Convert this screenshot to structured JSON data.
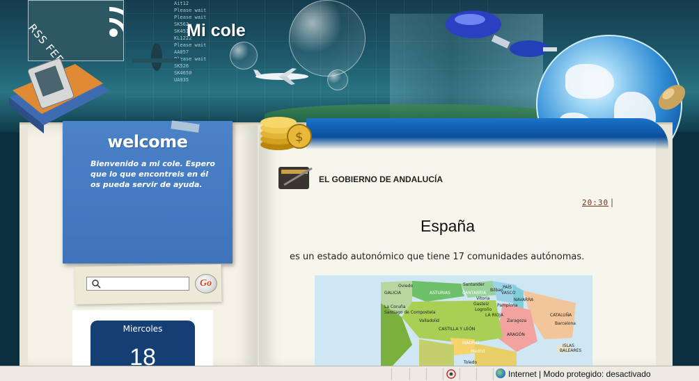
{
  "header": {
    "site_title": "Mi cole",
    "rss_label": "RSS FEED"
  },
  "flight_board": [
    "Ait12",
    "Please wait",
    "Please wait",
    "SK562",
    "SK451",
    "KL1222",
    "Please wait",
    "AA057",
    "Please wait",
    "SK526",
    "SK4650",
    "UA935"
  ],
  "sidebar": {
    "welcome_title": "welcome",
    "welcome_text": "Bienvenido a mi cole. Espero que lo que encontreis en él os pueda servir de ayuda.",
    "search_placeholder": "",
    "search_button_label": "Go",
    "calendar": {
      "day_name": "Miercoles",
      "day_number": "18"
    }
  },
  "post": {
    "title": "EL GOBIERNO DE ANDALUCÍA",
    "time": "20:30",
    "separator": "|",
    "heading": "España",
    "body": "es un estado autonómico que tiene 17 comunidades autónomas.",
    "map_labels": {
      "galicia": "GALICIA",
      "asturias": "ASTURIAS",
      "oviedo": "Oviedo",
      "santander": "Santander",
      "bilbao": "Bilbao",
      "pais": "PAÍS",
      "vasco": "VASCO",
      "cantabria": "CANTABRIA",
      "coruna": "La Coruña",
      "santiago": "Santiago de Compostela",
      "vitoria": "Vitoria",
      "navarra": "NAVARRA",
      "pamplona": "Pamplona",
      "logrono": "Logroño",
      "rioja": "LA RIOJA",
      "gasteiz": "Gasteiz",
      "cataluna": "CATALUÑA",
      "valladolid": "Valladolid",
      "zaragoza": "Zaragoza",
      "barcelona": "Barcelona",
      "castilla_leon": "CASTILLA Y LEÓN",
      "aragon": "ARAGÓN",
      "madrid_c": "MADRID",
      "madrid": "Madrid",
      "toledo": "Toledo",
      "islas": "ISLAS",
      "baleares": "BALEARES"
    }
  },
  "statusbar": {
    "zone_text": "Internet | Modo protegido: desactivado"
  },
  "colors": {
    "welcome_blue": "#4b82c8",
    "calendar_navy": "#143e74",
    "band_blue": "#1b73c8"
  }
}
